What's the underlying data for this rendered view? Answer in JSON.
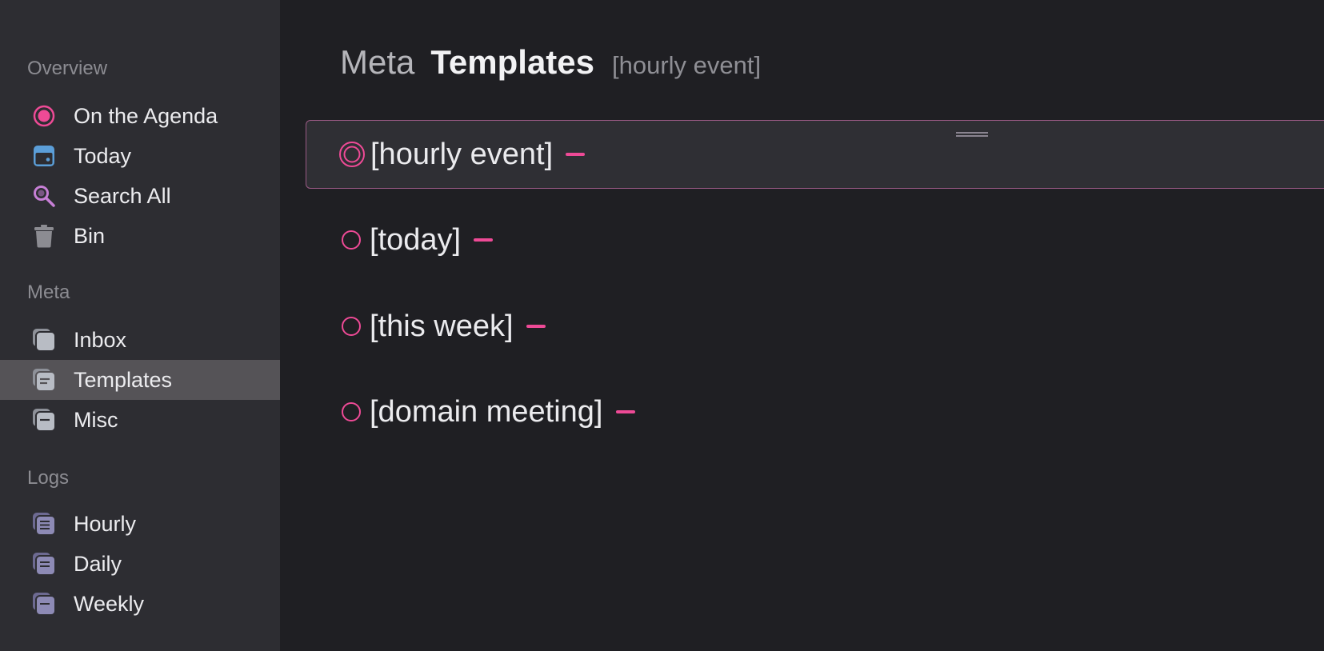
{
  "sidebar": {
    "sections": [
      {
        "title": "Overview",
        "items": [
          {
            "label": "On the Agenda",
            "icon": "agenda-target-icon"
          },
          {
            "label": "Today",
            "icon": "calendar-icon"
          },
          {
            "label": "Search All",
            "icon": "search-icon"
          },
          {
            "label": "Bin",
            "icon": "trash-icon"
          }
        ]
      },
      {
        "title": "Meta",
        "items": [
          {
            "label": "Inbox",
            "icon": "stack-icon"
          },
          {
            "label": "Templates",
            "icon": "stack-list-icon",
            "selected": true
          },
          {
            "label": "Misc",
            "icon": "stack-icon"
          }
        ]
      },
      {
        "title": "Logs",
        "items": [
          {
            "label": "Hourly",
            "icon": "stack-list-icon"
          },
          {
            "label": "Daily",
            "icon": "stack-list-icon"
          },
          {
            "label": "Weekly",
            "icon": "stack-icon"
          }
        ]
      }
    ]
  },
  "main": {
    "breadcrumb": {
      "parent": "Meta",
      "current": "Templates",
      "filter": "[hourly event]"
    },
    "items": [
      {
        "label": "[hourly event]",
        "focused": true
      },
      {
        "label": "[today]",
        "focused": false
      },
      {
        "label": "[this week]",
        "focused": false
      },
      {
        "label": "[domain meeting]",
        "focused": false
      }
    ]
  },
  "colors": {
    "accent": "#ee4a96",
    "sidebar_bg": "#2d2d32",
    "main_bg": "#1f1f23",
    "selected_bg": "#555357",
    "today_icon": "#5b9ed8",
    "search_icon": "#c77fd6",
    "meta_icon": "#b8bcc4",
    "logs_icon": "#8d8ab5"
  }
}
